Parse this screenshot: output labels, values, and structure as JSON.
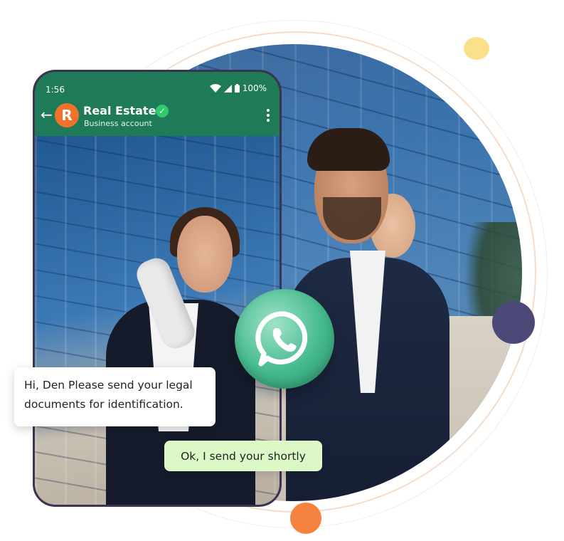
{
  "status_bar": {
    "time": "1:56",
    "battery": "100%"
  },
  "chat_header": {
    "avatar_letter": "R",
    "contact_name": "Real Estate",
    "subtitle": "Business account"
  },
  "messages": [
    {
      "direction": "incoming",
      "text": "Hi, Den Please send your legal documents for identification."
    },
    {
      "direction": "outgoing",
      "text": "Ok, I send your shortly"
    }
  ],
  "colors": {
    "header_green": "#1f7a58",
    "avatar_orange": "#f2722b",
    "outgoing_bubble": "#dcf8c6",
    "accent_yellow": "#fbe08a",
    "accent_purple": "#4c4877",
    "accent_orange": "#f4833f"
  },
  "icons": [
    "back-arrow-icon",
    "verified-check-icon",
    "wifi-icon",
    "signal-icon",
    "battery-icon",
    "more-vertical-icon",
    "whatsapp-icon"
  ]
}
